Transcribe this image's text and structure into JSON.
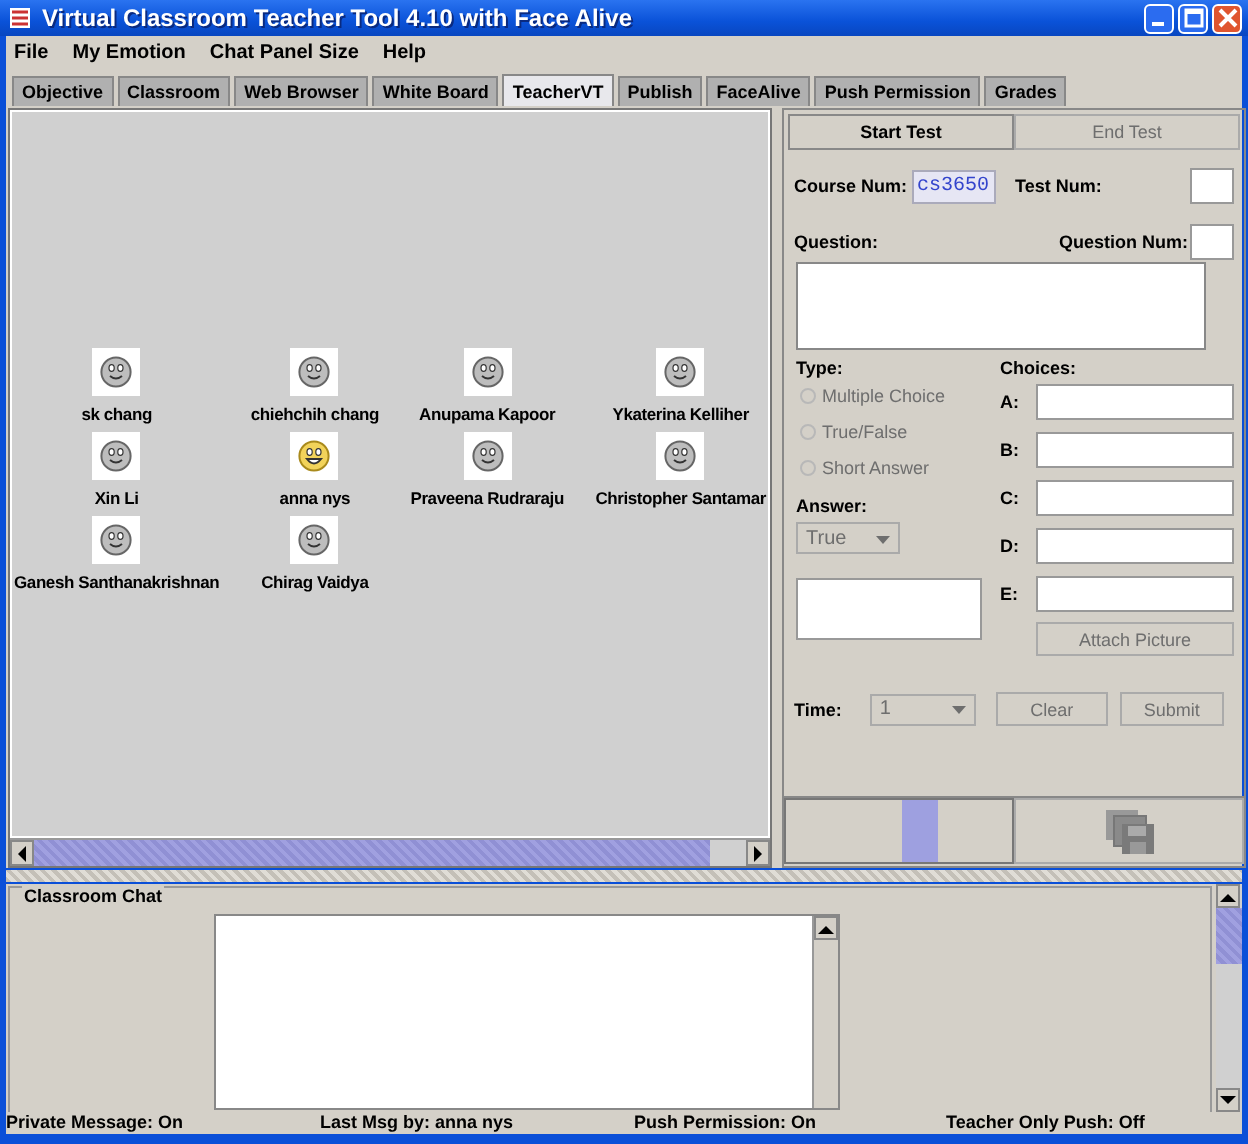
{
  "window": {
    "title": "Virtual Classroom Teacher Tool 4.10 with Face Alive"
  },
  "menu": [
    "File",
    "My Emotion",
    "Chat Panel Size",
    "Help"
  ],
  "tabs": [
    {
      "label": "Objective",
      "selected": false
    },
    {
      "label": "Classroom",
      "selected": false
    },
    {
      "label": "Web Browser",
      "selected": false
    },
    {
      "label": "White Board",
      "selected": false
    },
    {
      "label": "TeacherVT",
      "selected": true
    },
    {
      "label": "Publish",
      "selected": false
    },
    {
      "label": "FaceAlive",
      "selected": false
    },
    {
      "label": "Push Permission",
      "selected": false
    },
    {
      "label": "Grades",
      "selected": false
    }
  ],
  "students": [
    {
      "name": "sk chang",
      "kind": "neutral"
    },
    {
      "name": "chiehchih chang",
      "kind": "neutral"
    },
    {
      "name": "Anupama Kapoor",
      "kind": "neutral"
    },
    {
      "name": "Ykaterina Kelliher",
      "kind": "neutral"
    },
    {
      "name": "Xin Li",
      "kind": "neutral"
    },
    {
      "name": "anna nys",
      "kind": "happy"
    },
    {
      "name": "Praveena Rudraraju",
      "kind": "neutral"
    },
    {
      "name": "Christopher Santamar",
      "kind": "neutral"
    },
    {
      "name": "Ganesh Santhanakrishnan",
      "kind": "neutral"
    },
    {
      "name": "Chirag Vaidya",
      "kind": "neutral"
    }
  ],
  "test_panel": {
    "buttons": [
      {
        "label": "Start Test",
        "disabled": false
      },
      {
        "label": "End Test",
        "disabled": true
      }
    ],
    "course_num_label": "Course Num:",
    "course_num": "cs3650",
    "test_num_label": "Test Num:",
    "question_label": "Question:",
    "question_num_label": "Question Num:",
    "type_label": "Type:",
    "types": [
      {
        "label": "Multiple Choice",
        "selected": false,
        "disabled": true
      },
      {
        "label": "True/False",
        "selected": false,
        "disabled": true
      },
      {
        "label": "Short Answer",
        "selected": false,
        "disabled": true
      }
    ],
    "choices_label": "Choices:",
    "choices": [
      "A:",
      "B:",
      "C:",
      "D:",
      "E:"
    ],
    "answer_label": "Answer:",
    "answer": {
      "value": "True",
      "disabled": true
    },
    "attach_button": {
      "label": "Attach Picture",
      "disabled": true
    },
    "time_label": "Time:",
    "time": {
      "value": "1",
      "disabled": true
    },
    "clear_button": {
      "label": "Clear",
      "disabled": true
    },
    "submit_button": {
      "label": "Submit",
      "disabled": true
    }
  },
  "chat": {
    "title": "Classroom Chat"
  },
  "status_bar": [
    "Private Message: On",
    "Last Msg by: anna nys",
    "Push Permission: On",
    "Teacher Only Push: Off"
  ]
}
